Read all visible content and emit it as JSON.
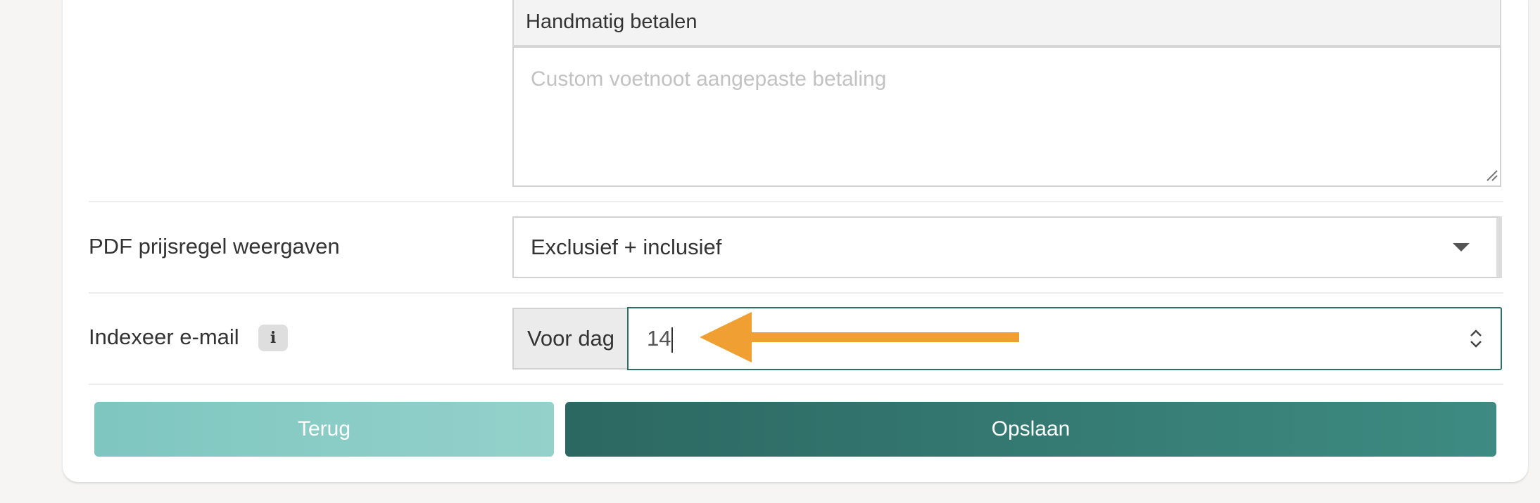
{
  "payment": {
    "header": "Handmatig betalen",
    "footnote_placeholder": "Custom voetnoot aangepaste betaling",
    "footnote_value": ""
  },
  "pdf_price_line": {
    "label": "PDF prijsregel weergaven",
    "selected": "Exclusief + inclusief"
  },
  "index_email": {
    "label": "Indexeer e-mail",
    "info_icon_glyph": "i",
    "addon": "Voor dag",
    "value": "14"
  },
  "buttons": {
    "back": "Terug",
    "save": "Opslaan"
  },
  "colors": {
    "primary": "#2f6d66",
    "secondary": "#8dcdc7",
    "annotation_arrow": "#f0a033"
  }
}
